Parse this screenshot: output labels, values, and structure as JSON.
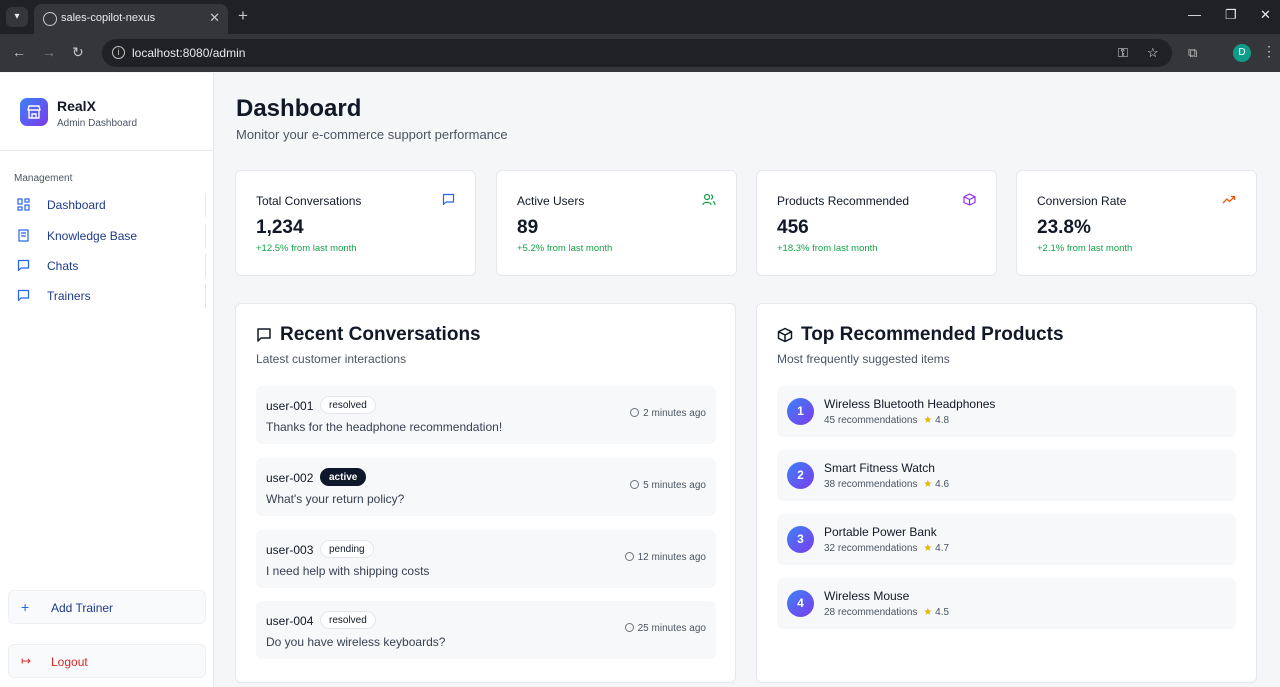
{
  "browser": {
    "tab_title": "sales-copilot-nexus",
    "url": "localhost:8080/admin",
    "profile_initial": "D"
  },
  "sidebar": {
    "brand_name": "RealX",
    "brand_subtitle": "Admin Dashboard",
    "section_label": "Management",
    "items": [
      {
        "label": "Dashboard",
        "icon": "grid-icon"
      },
      {
        "label": "Knowledge Base",
        "icon": "book-icon"
      },
      {
        "label": "Chats",
        "icon": "message-icon"
      },
      {
        "label": "Trainers",
        "icon": "message-icon"
      }
    ],
    "add_trainer_label": "Add Trainer",
    "logout_label": "Logout"
  },
  "header": {
    "title": "Dashboard",
    "subtitle": "Monitor your e-commerce support performance"
  },
  "stats": [
    {
      "label": "Total Conversations",
      "value": "1,234",
      "change": "+12.5% from last month",
      "icon": "message-icon",
      "color": "#2563eb"
    },
    {
      "label": "Active Users",
      "value": "89",
      "change": "+5.2% from last month",
      "icon": "users-icon",
      "color": "#16a34a"
    },
    {
      "label": "Products Recommended",
      "value": "456",
      "change": "+18.3% from last month",
      "icon": "package-icon",
      "color": "#9333ea"
    },
    {
      "label": "Conversion Rate",
      "value": "23.8%",
      "change": "+2.1% from last month",
      "icon": "trending-up-icon",
      "color": "#ea580c"
    }
  ],
  "recent_conversations": {
    "title": "Recent Conversations",
    "subtitle": "Latest customer interactions",
    "items": [
      {
        "user": "user-001",
        "status": "resolved",
        "message": "Thanks for the headphone recommendation!",
        "time": "2 minutes ago"
      },
      {
        "user": "user-002",
        "status": "active",
        "message": "What's your return policy?",
        "time": "5 minutes ago"
      },
      {
        "user": "user-003",
        "status": "pending",
        "message": "I need help with shipping costs",
        "time": "12 minutes ago"
      },
      {
        "user": "user-004",
        "status": "resolved",
        "message": "Do you have wireless keyboards?",
        "time": "25 minutes ago"
      }
    ]
  },
  "top_products": {
    "title": "Top Recommended Products",
    "subtitle": "Most frequently suggested items",
    "items": [
      {
        "rank": "1",
        "name": "Wireless Bluetooth Headphones",
        "recommendations": "45 recommendations",
        "rating": "4.8"
      },
      {
        "rank": "2",
        "name": "Smart Fitness Watch",
        "recommendations": "38 recommendations",
        "rating": "4.6"
      },
      {
        "rank": "3",
        "name": "Portable Power Bank",
        "recommendations": "32 recommendations",
        "rating": "4.7"
      },
      {
        "rank": "4",
        "name": "Wireless Mouse",
        "recommendations": "28 recommendations",
        "rating": "4.5"
      }
    ]
  }
}
